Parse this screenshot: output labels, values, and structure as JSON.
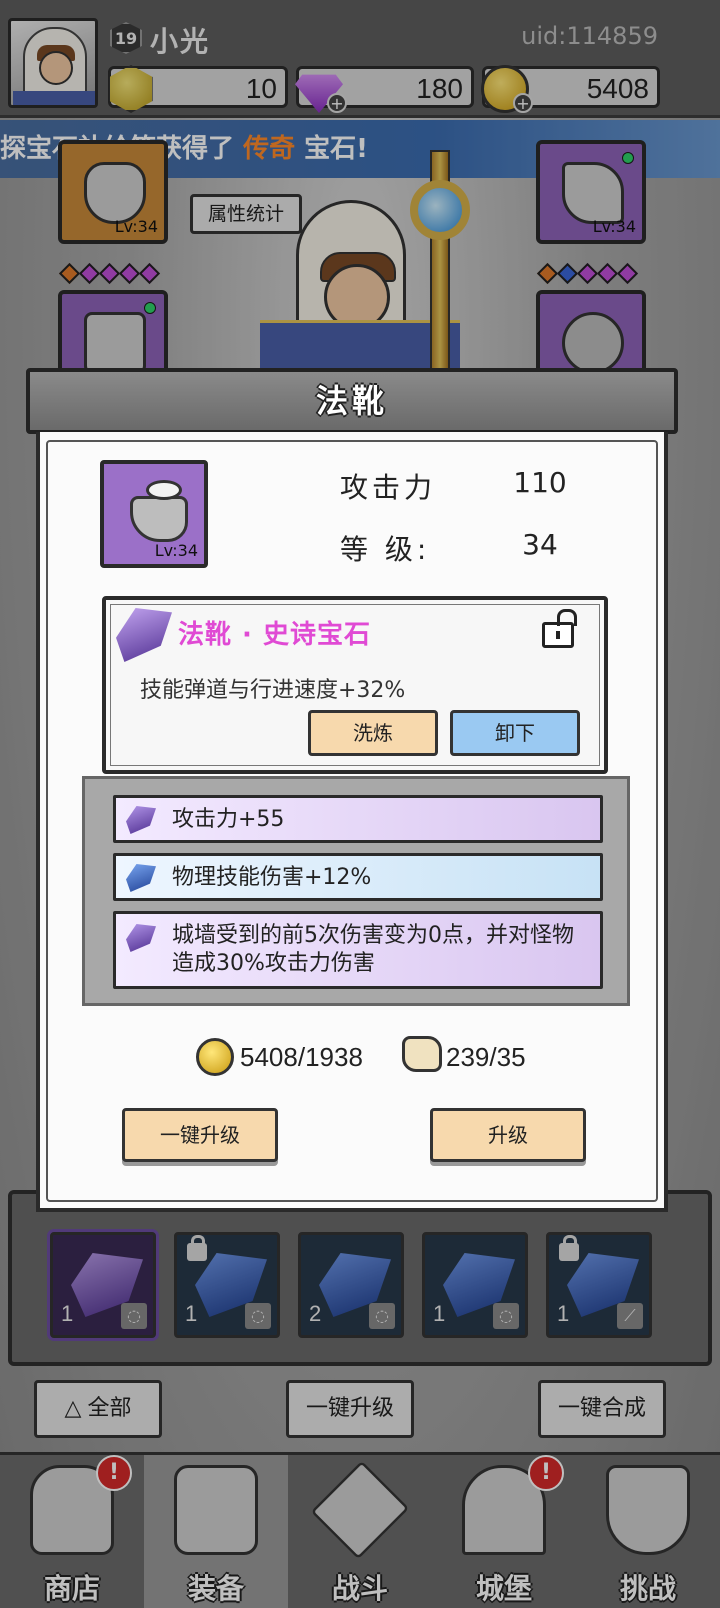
{
  "player": {
    "name": "小光",
    "level": "19",
    "uid": "uid:114859"
  },
  "currencies": {
    "gold_hex": "10",
    "gems": "180",
    "coins": "5408"
  },
  "banner": {
    "prefix": "探宝石补给箱获得了 ",
    "highlight": "传奇",
    "suffix": " 宝石!"
  },
  "equipment": {
    "stats_button": "属性统计",
    "helmet_level": "Lv:34",
    "weapon_level": "Lv:34"
  },
  "modal": {
    "title": "法靴",
    "item_level_badge": "Lv:34",
    "stats": [
      {
        "label": "攻击力",
        "value": "110"
      },
      {
        "label": "等 级:",
        "value": "34"
      }
    ],
    "gem": {
      "title": "法靴 · 史诗宝石",
      "description": "技能弹道与行进速度+32%",
      "reroll_label": "洗炼",
      "remove_label": "卸下"
    },
    "attributes": [
      {
        "text": "攻击力+55",
        "color": "purple"
      },
      {
        "text": "物理技能伤害+12%",
        "color": "blue"
      },
      {
        "text": "城墙受到的前5次伤害变为0点，并对怪物造成30%攻击力伤害",
        "color": "purple"
      }
    ],
    "costs": {
      "gold": "5408/1938",
      "scroll": "239/35"
    },
    "one_click_upgrade": "一键升级",
    "upgrade": "升级"
  },
  "gem_inventory": [
    {
      "count": "1",
      "color": "purple",
      "locked": false
    },
    {
      "count": "1",
      "color": "blue",
      "locked": true
    },
    {
      "count": "2",
      "color": "blue",
      "locked": false
    },
    {
      "count": "1",
      "color": "blue",
      "locked": false
    },
    {
      "count": "1",
      "color": "blue",
      "locked": true
    }
  ],
  "bottom_actions": {
    "all": "全部",
    "one_click_upgrade": "一键升级",
    "one_click_merge": "一键合成"
  },
  "nav": [
    {
      "label": "商店",
      "badge": "!"
    },
    {
      "label": "装备",
      "badge": ""
    },
    {
      "label": "战斗",
      "badge": ""
    },
    {
      "label": "城堡",
      "badge": "!"
    },
    {
      "label": "挑战",
      "badge": ""
    }
  ],
  "colors": {
    "gem_title": "#e04ad4",
    "banner_highlight": "#ff8a2a",
    "reroll_button": "#f7d9ad",
    "remove_button": "#9ac9f2"
  }
}
